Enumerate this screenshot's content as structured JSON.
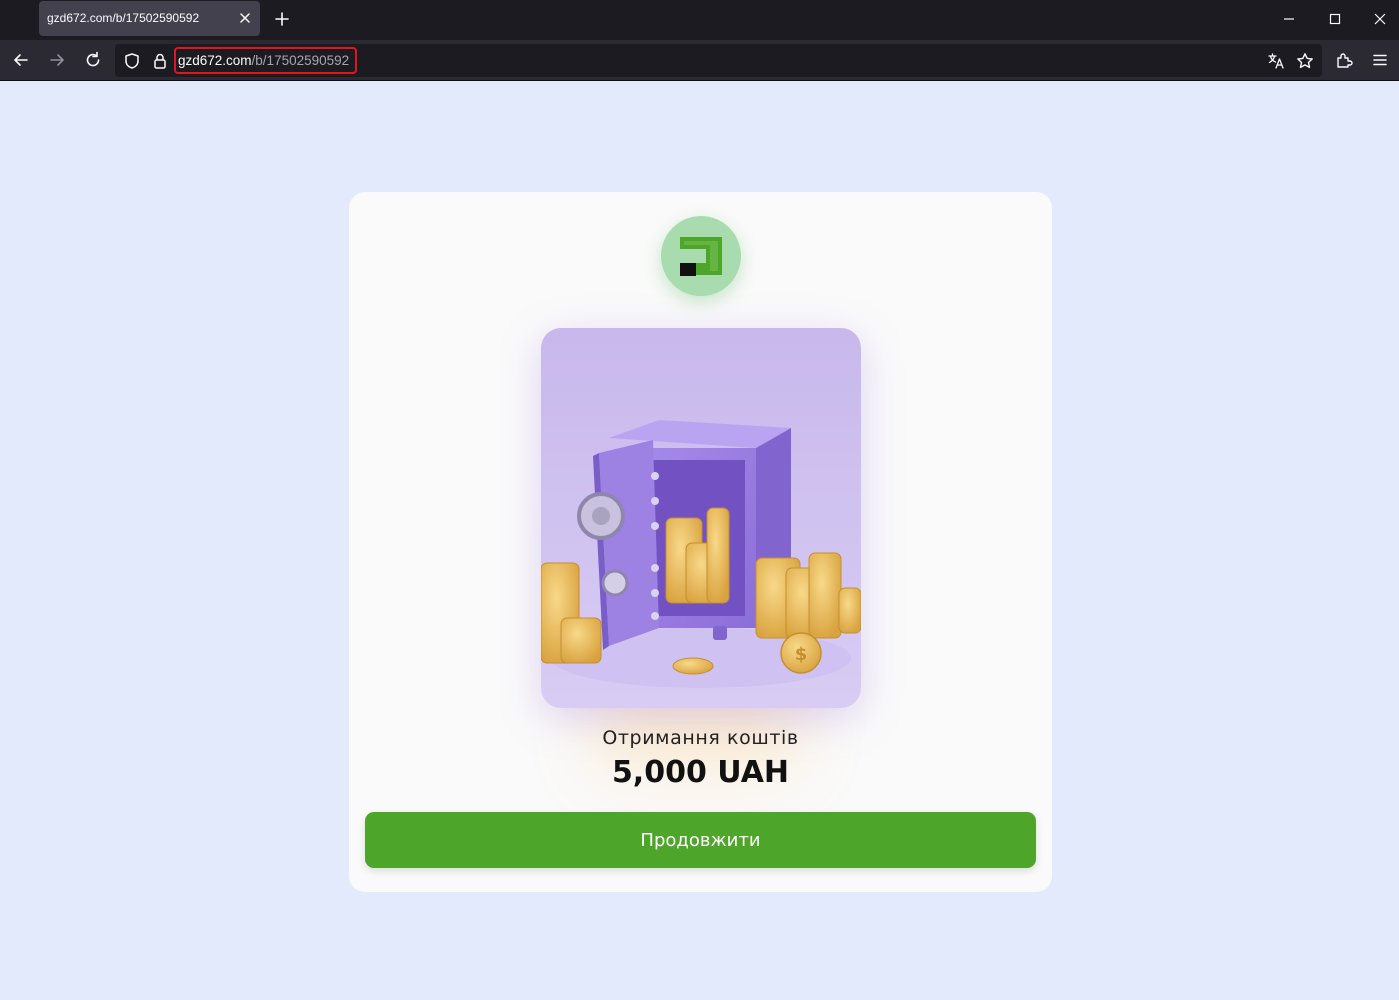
{
  "browser": {
    "tab": {
      "title": "gzd672.com/b/17502590592"
    },
    "address": {
      "host": "gzd672.com",
      "path": "/b/17502590592"
    }
  },
  "page": {
    "caption": "Отримання коштів",
    "amount": "5,000 UAH",
    "continue_label": "Продовжити",
    "colors": {
      "background": "#e2eafc",
      "button": "#4da529",
      "logo_circle": "#a8dcae",
      "logo_mark": "#4da529"
    }
  },
  "icons": [
    "close-icon",
    "plus-icon",
    "minimize-icon",
    "maximize-icon",
    "back-arrow-icon",
    "forward-arrow-icon",
    "reload-icon",
    "shield-icon",
    "lock-icon",
    "translate-icon",
    "bookmark-star-icon",
    "extensions-icon",
    "menu-icon",
    "privatbank-logo-icon"
  ]
}
